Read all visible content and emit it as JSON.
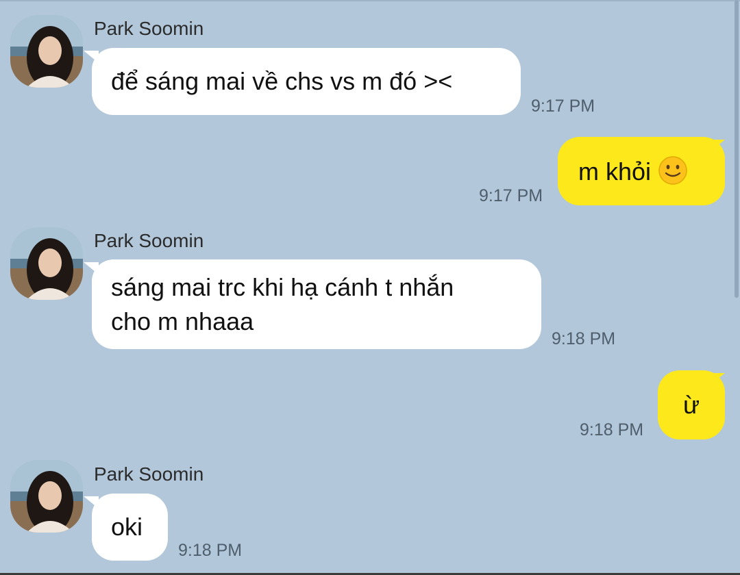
{
  "chat": {
    "messages": [
      {
        "sender": "Park Soomin",
        "text": "để sáng mai về chs vs m đó ><",
        "time": "9:17 PM"
      },
      {
        "text": "m khỏi",
        "emoji": "slightly-smiling-face-icon",
        "time": "9:17 PM"
      },
      {
        "sender": "Park Soomin",
        "line1": "sáng mai trc khi hạ cánh t nhắn",
        "line2": "cho m nhaaa",
        "time": "9:18 PM"
      },
      {
        "text": "ừ",
        "time": "9:18 PM"
      },
      {
        "sender": "Park Soomin",
        "text": "oki",
        "time": "9:18 PM"
      }
    ]
  },
  "colors": {
    "background": "#b2c7da",
    "incoming_bubble": "#ffffff",
    "outgoing_bubble": "#fde81c"
  }
}
